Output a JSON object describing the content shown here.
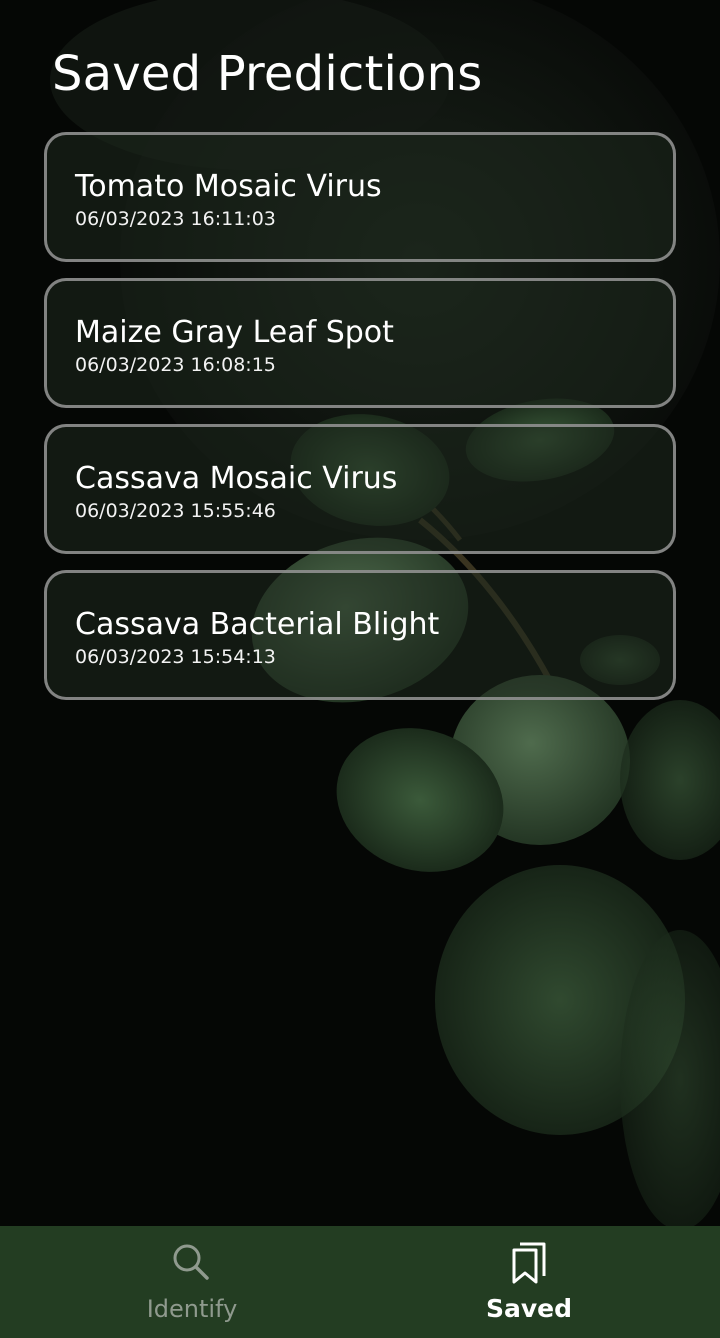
{
  "header": {
    "title": "Saved Predictions"
  },
  "predictions": [
    {
      "name": "Tomato Mosaic Virus",
      "timestamp": "06/03/2023 16:11:03"
    },
    {
      "name": "Maize Gray Leaf Spot",
      "timestamp": "06/03/2023 16:08:15"
    },
    {
      "name": "Cassava Mosaic Virus",
      "timestamp": "06/03/2023 15:55:46"
    },
    {
      "name": "Cassava Bacterial Blight",
      "timestamp": "06/03/2023 15:54:13"
    }
  ],
  "bottom_nav": {
    "items": [
      {
        "label": "Identify",
        "icon": "search-icon",
        "active": false
      },
      {
        "label": "Saved",
        "icon": "bookmarks-icon",
        "active": true
      }
    ]
  },
  "colors": {
    "nav_background": "#233d22",
    "active_label": "#ffffff",
    "inactive_label": "#8f9a8e",
    "card_border": "#969696"
  }
}
